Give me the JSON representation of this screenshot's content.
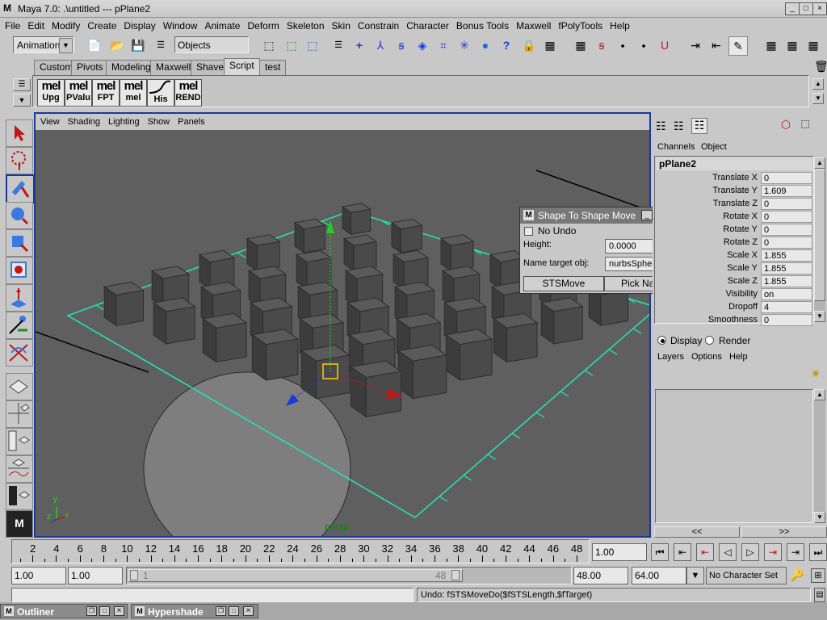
{
  "window": {
    "title": "Maya 7.0: .\\untitled   ---   pPlane2",
    "controls": [
      "_",
      "□",
      "×"
    ]
  },
  "menubar": [
    "File",
    "Edit",
    "Modify",
    "Create",
    "Display",
    "Window",
    "Animate",
    "Deform",
    "Skeleton",
    "Skin",
    "Constrain",
    "Character",
    "Bonus Tools",
    "Maxwell",
    "fPolyTools",
    "Help"
  ],
  "statusline": {
    "menu_set": "Animation",
    "selection_field": "Objects"
  },
  "shelf": {
    "tabs": [
      "Custom",
      "Pivots",
      "Modeling",
      "Maxwell",
      "Shave",
      "Script",
      "test"
    ],
    "active_tab": "Script",
    "buttons": [
      {
        "top": "mel",
        "bottom": "Upg"
      },
      {
        "top": "mel",
        "bottom": "PValu"
      },
      {
        "top": "mel",
        "bottom": "FPT"
      },
      {
        "top": "mel",
        "bottom": "mel"
      },
      {
        "top": "",
        "bottom": "His"
      },
      {
        "top": "mel",
        "bottom": "REND"
      }
    ]
  },
  "viewport": {
    "menu": [
      "View",
      "Shading",
      "Lighting",
      "Show",
      "Panels"
    ],
    "camera_label": "persp",
    "axis": {
      "x": "x",
      "y": "y",
      "z": "z"
    },
    "colors": {
      "background": "#5f5f5f",
      "grid": "#20e8b0",
      "cube_top": "#5a5a5a",
      "cube_front": "#4a4a4a",
      "cube_side": "#3c3c3c",
      "active_border": "#1a3a9a"
    }
  },
  "channelbox": {
    "menu": [
      "Channels",
      "Object"
    ],
    "object_name": "pPlane2",
    "channels": [
      {
        "name": "Translate X",
        "value": "0"
      },
      {
        "name": "Translate Y",
        "value": "1.609"
      },
      {
        "name": "Translate Z",
        "value": "0"
      },
      {
        "name": "Rotate X",
        "value": "0"
      },
      {
        "name": "Rotate Y",
        "value": "0"
      },
      {
        "name": "Rotate Z",
        "value": "0"
      },
      {
        "name": "Scale X",
        "value": "1.855"
      },
      {
        "name": "Scale Y",
        "value": "1.855"
      },
      {
        "name": "Scale Z",
        "value": "1.855"
      },
      {
        "name": "Visibility",
        "value": "on"
      },
      {
        "name": "Dropoff",
        "value": "4"
      },
      {
        "name": "Smoothness",
        "value": "0"
      }
    ]
  },
  "layers": {
    "display_label": "Display",
    "render_label": "Render",
    "menu": [
      "Layers",
      "Options",
      "Help"
    ],
    "scroll_left": "<<",
    "scroll_right": ">>"
  },
  "dialog": {
    "title": "Shape To Shape Move",
    "no_undo_label": "No Undo",
    "height_label": "Height:",
    "height_value": "0.0000",
    "target_label": "Name target obj:",
    "target_value": "nurbsSphere1",
    "btn_move": "STSMove",
    "btn_pick": "Pick Name"
  },
  "timeslider": {
    "ticks": [
      "2",
      "4",
      "6",
      "8",
      "10",
      "12",
      "14",
      "16",
      "18",
      "20",
      "22",
      "24",
      "26",
      "28",
      "30",
      "32",
      "34",
      "36",
      "38",
      "40",
      "42",
      "44",
      "46",
      "48"
    ],
    "current_time": "1.00"
  },
  "rangeslider": {
    "start_time": "1.00",
    "start_range": "1.00",
    "range_min_label": "1",
    "range_max_label": "48",
    "end_range": "48.00",
    "end_time": "64.00",
    "character_set": "No Character Set"
  },
  "commandline": {
    "result": "Undo: fSTSMoveDo($fSTSLength,$fTarget)"
  },
  "taskbar": [
    {
      "label": "Outliner"
    },
    {
      "label": "Hypershade"
    }
  ]
}
